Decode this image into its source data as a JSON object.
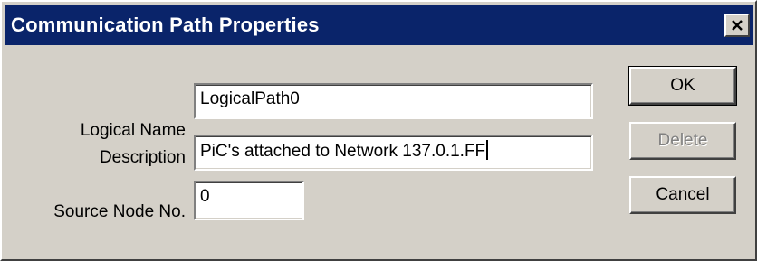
{
  "dialog": {
    "title": "Communication Path Properties",
    "close_icon": "close-icon"
  },
  "form": {
    "logical_name_label": "Logical Name",
    "logical_name_value": "LogicalPath0",
    "description_label": "Description",
    "description_value": "PiC's attached to Network 137.0.1.FF",
    "source_node_label": "Source Node No.",
    "source_node_value": "0"
  },
  "buttons": {
    "ok_label": "OK",
    "delete_label": "Delete",
    "delete_enabled": false,
    "cancel_label": "Cancel"
  },
  "colors": {
    "titlebar": "#0a246a",
    "face": "#d4d0c8"
  }
}
